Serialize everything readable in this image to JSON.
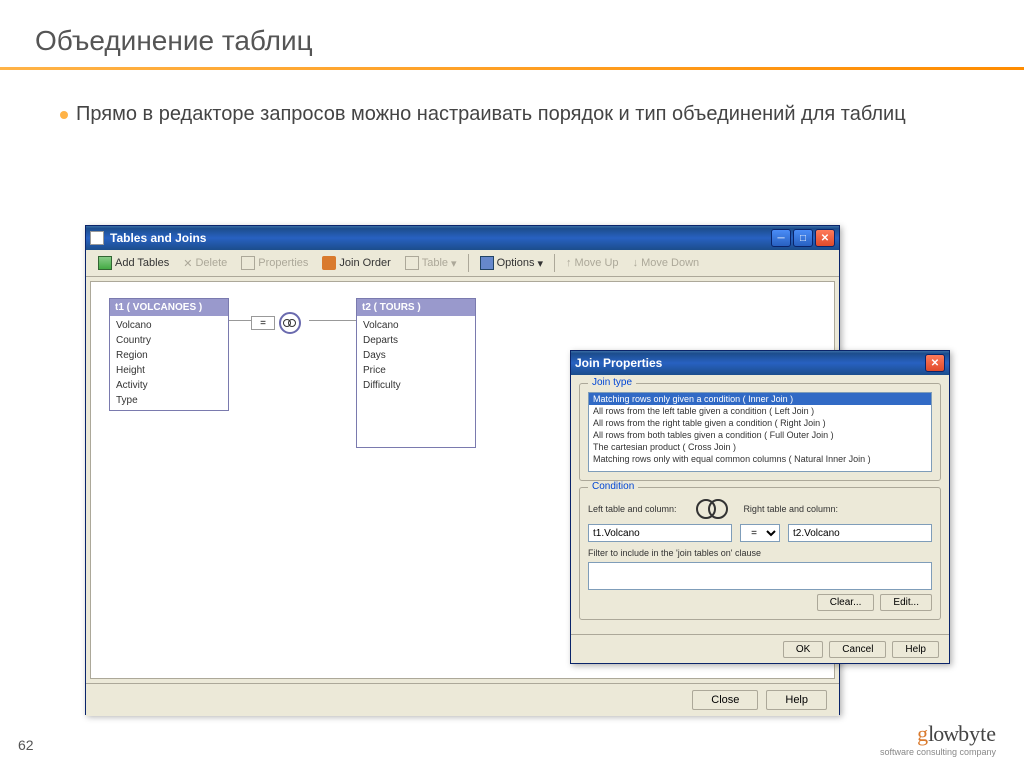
{
  "slide": {
    "title": "Объединение таблиц",
    "bullet": "Прямо в редакторе запросов можно настраивать порядок и тип объединений для таблиц",
    "page_number": "62"
  },
  "main_window": {
    "title": "Tables and Joins",
    "toolbar": {
      "add_tables": "Add Tables",
      "delete": "Delete",
      "properties": "Properties",
      "join_order": "Join Order",
      "table": "Table",
      "options": "Options",
      "move_up": "Move Up",
      "move_down": "Move Down"
    },
    "t1": {
      "header": "t1 ( VOLCANOES )",
      "fields": [
        "Volcano",
        "Country",
        "Region",
        "Height",
        "Activity",
        "Type"
      ]
    },
    "t2": {
      "header": "t2 ( TOURS )",
      "fields": [
        "Volcano",
        "Departs",
        "Days",
        "Price",
        "Difficulty"
      ]
    },
    "join_symbol": "=",
    "close": "Close",
    "help": "Help"
  },
  "prop_window": {
    "title": "Join Properties",
    "join_type_label": "Join type",
    "join_types": [
      "Matching rows only given a condition ( Inner Join )",
      "All rows from the left table given a condition ( Left Join )",
      "All rows from the right table given a condition ( Right Join )",
      "All rows from both tables given a condition ( Full Outer Join )",
      "The cartesian product ( Cross Join )",
      "Matching rows only with equal common columns ( Natural Inner Join )"
    ],
    "condition_label": "Condition",
    "left_col_label": "Left table and column:",
    "right_col_label": "Right table and column:",
    "left_value": "t1.Volcano",
    "operator": "=",
    "right_value": "t2.Volcano",
    "filter_label": "Filter to include in the 'join tables on' clause",
    "clear": "Clear...",
    "edit": "Edit...",
    "ok": "OK",
    "cancel": "Cancel",
    "help": "Help"
  },
  "logo": {
    "name_g": "g",
    "name_low": "low",
    "name_byte": "byte",
    "tagline": "software consulting company"
  }
}
